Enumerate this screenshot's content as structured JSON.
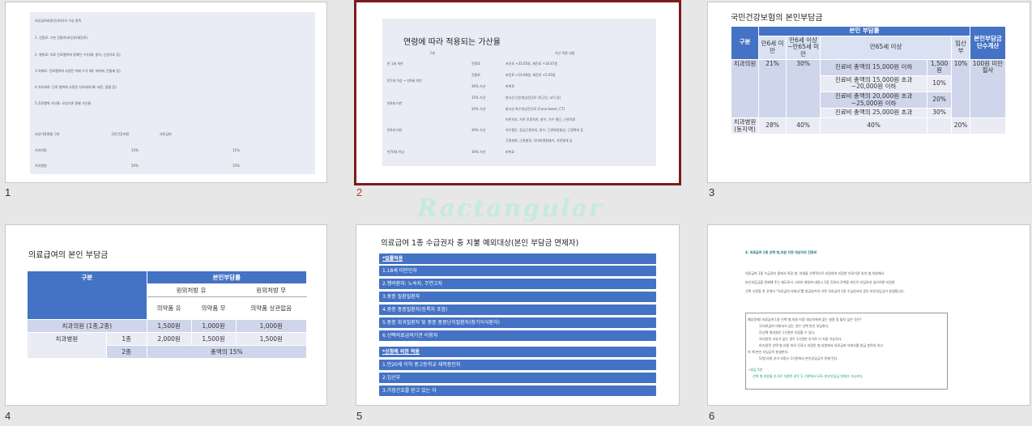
{
  "slides": [
    {
      "number": "1"
    },
    {
      "number": "2"
    },
    {
      "number": "3"
    },
    {
      "number": "4"
    },
    {
      "number": "5"
    },
    {
      "number": "6"
    }
  ],
  "watermark": "Ractangular",
  "slide1": {
    "lines": [
      "요양급여비용(진료비)의 구성 항목",
      "1. 진찰료: 기본 진찰료(초진료/재진료)",
      "2. 행위료: 의료 진료행위에 정해진 수가(예: 발치, 신경치료 등)",
      "3.약제료: 진료행위에 사용된 약제 수가 (예: 마취제, 진통제 등)",
      "4.치료재료: 진료 행위에 사용된 치료재료(예: 레진, 필름 등)",
      "5.진료행위 가산율: 요양기관 종별 가산율"
    ],
    "table_header": [
      "요양기관종별 구분",
      "국민건강보험",
      "의료급여"
    ],
    "rows": [
      [
        "치과의원",
        "15%",
        "11%"
      ],
      [
        "치과병원",
        "20%",
        "15%"
      ]
    ]
  },
  "slide2": {
    "title": "연령에 따라 적용되는 가산율",
    "header": [
      "구분",
      "가산 적용 내용"
    ],
    "rows": [
      [
        "만 1세 미만",
        "진찰료",
        "초진료 +35.65원, 재진료 +16.67원"
      ],
      [
        "",
        "진찰료",
        "초진료 +10.68원, 재진료 +5.05원"
      ],
      [
        "만1세 이상 ~ 만6세 미만",
        "30% 가산",
        "마취료"
      ],
      [
        "",
        "15% 가산",
        "방사선 단순영상진단료 (치근단, 교익 등)"
      ],
      [
        "만6세 미만",
        "20% 가산",
        "방사선 특수영상진단료 (Cone beam, CT)"
      ],
      [
        "",
        "",
        "보존처치, 치아 진정처치, 발수, 치수 절단, 근관치료"
      ],
      [
        "만6세 미만",
        "30% 가산",
        "치수절단, 응급근관처치, 발수, 근관와동형성, 근관확대 등"
      ],
      [
        "",
        "",
        "근관세척, 근관충전, 치아파절편제거, 치관열개 등"
      ],
      [
        "만70세 이상",
        "30% 가산",
        "마취료"
      ]
    ]
  },
  "slide3": {
    "title": "국민건강보험의 본인부담금",
    "head": {
      "category": "구분",
      "copay": "본인 부담률",
      "unit": "본인부담금 단수계산"
    },
    "subhead": [
      "만6세 미만",
      "만6세 이상~만65세 미만",
      "만65세 이상",
      "임산부"
    ],
    "clinic": "치과의원",
    "clinic_u6": "21%",
    "clinic_6to65": "30%",
    "elderly_tiers": [
      {
        "cond": "진료비 총액의 15,000원 이하",
        "val": "1,500원"
      },
      {
        "cond": "진료비 총액의 15,000원 초과 ~20,000원 이하",
        "val": "10%"
      },
      {
        "cond": "진료비 총액의 20,000원 초과 ~25,000원 이하",
        "val": "20%"
      },
      {
        "cond": "진료비 총액의 25,000원 초과",
        "val": "30%"
      }
    ],
    "clinic_preg": "10%",
    "unit_note": "100원 미만 절사",
    "hospital": "치과병원 (동지역)",
    "hospital_u6": "28%",
    "hospital_6to65": "40%",
    "hospital_65": "40%",
    "hospital_preg": "20%"
  },
  "slide4": {
    "title": "의료급여의 본인 부담금",
    "head": {
      "category": "구분",
      "copay": "본인부담률"
    },
    "sub1": [
      "원외처방 유",
      "원외처방 무"
    ],
    "sub2": [
      "의약품 유",
      "의약품 무",
      "의약품 상관없음"
    ],
    "rows": [
      {
        "a": "치과의원 (1종,2종)",
        "b": "",
        "v": [
          "1,500원",
          "1,000원",
          "1,000원"
        ]
      },
      {
        "a": "치과병원",
        "b": "1종",
        "v": [
          "2,000원",
          "1,500원",
          "1,500원"
        ]
      },
      {
        "a": "",
        "b": "2종",
        "v": [
          "총액의 15%"
        ]
      }
    ]
  },
  "slide5": {
    "title": "의료급여 1종 수급권자 중 지불 예외대상(본인 부담금 면제자)",
    "items": [
      {
        "text": "*일률적용",
        "underline": true
      },
      {
        "text": "1.18세 미만인자",
        "underline": false
      },
      {
        "text": "2.행려환자: 노숙자, 무연고자",
        "underline": false
      },
      {
        "text": "3.중증 질환질환자",
        "underline": false
      },
      {
        "text": "4.중증 중증질환자(등록자 포함)",
        "underline": false
      },
      {
        "text": "5.중증 희귀질환자 및 중증 중증난치질환자(장기이식환자)",
        "underline": false
      },
      {
        "text": "6.선택의료급여기관 이용자",
        "underline": false
      },
      {
        "text": "*신청에 의한 적용",
        "underline": true
      },
      {
        "text": "1.만20세 이하 중고등학교 재학중인자",
        "underline": false
      },
      {
        "text": "2.임산부",
        "underline": false
      },
      {
        "text": "3.가정간호를 받고 있는 자",
        "underline": false
      }
    ]
  },
  "slide6": {
    "heading": "4. 의료급여 1종 선택 병,의원 지정 대상자의 진료비",
    "para": [
      "의료급여 1종 수급권자 중에서 특정 병, 의원을 선택적으로 지정하여 지정한 의료기관 외의 병,의원에서",
      "본인부담금을 면제해 주는 제도로서 그외의 병원에 내원시 1종 진료비 전액을 본인이 부담하지 않으려면 지정한",
      "선택 기관을 한 곳에서 \"의료급여 의뢰서\"를 발급받아야 기존 의료급여 1종 수급권자와 같은 본인부담금이 발생합니다."
    ],
    "box": [
      "예상문제) 의료급여 1종 선택 병,의원 지정 대상자에게 맞는 설명 중 옳지 않은 것은?",
      "1)의료급여 의뢰서가 없는 경우 선택 본인 부담한다.",
      "2)선택 병의원은 1기관만 지정할 수 있다.",
      "3)지정된 사유가 없는 경우 1기관만 추가로 더 지정 가능하다.",
      "4)지정된 선택 병,의원 외의 진료시 지정된 병,의원에서 의료급여 의뢰서를 발급 받아야 하고",
      "미 해 본인 부담금이 발생한다.",
      "5)병,의원 추가 지정시 1기관에서 본인부담금이 면제 된다."
    ],
    "answer_label": "→정답 5번",
    "answer": "선택 병,의원을 추가로 지정한 경우 두 기관에서 모두 본인부담금 면제가 가능하다."
  }
}
